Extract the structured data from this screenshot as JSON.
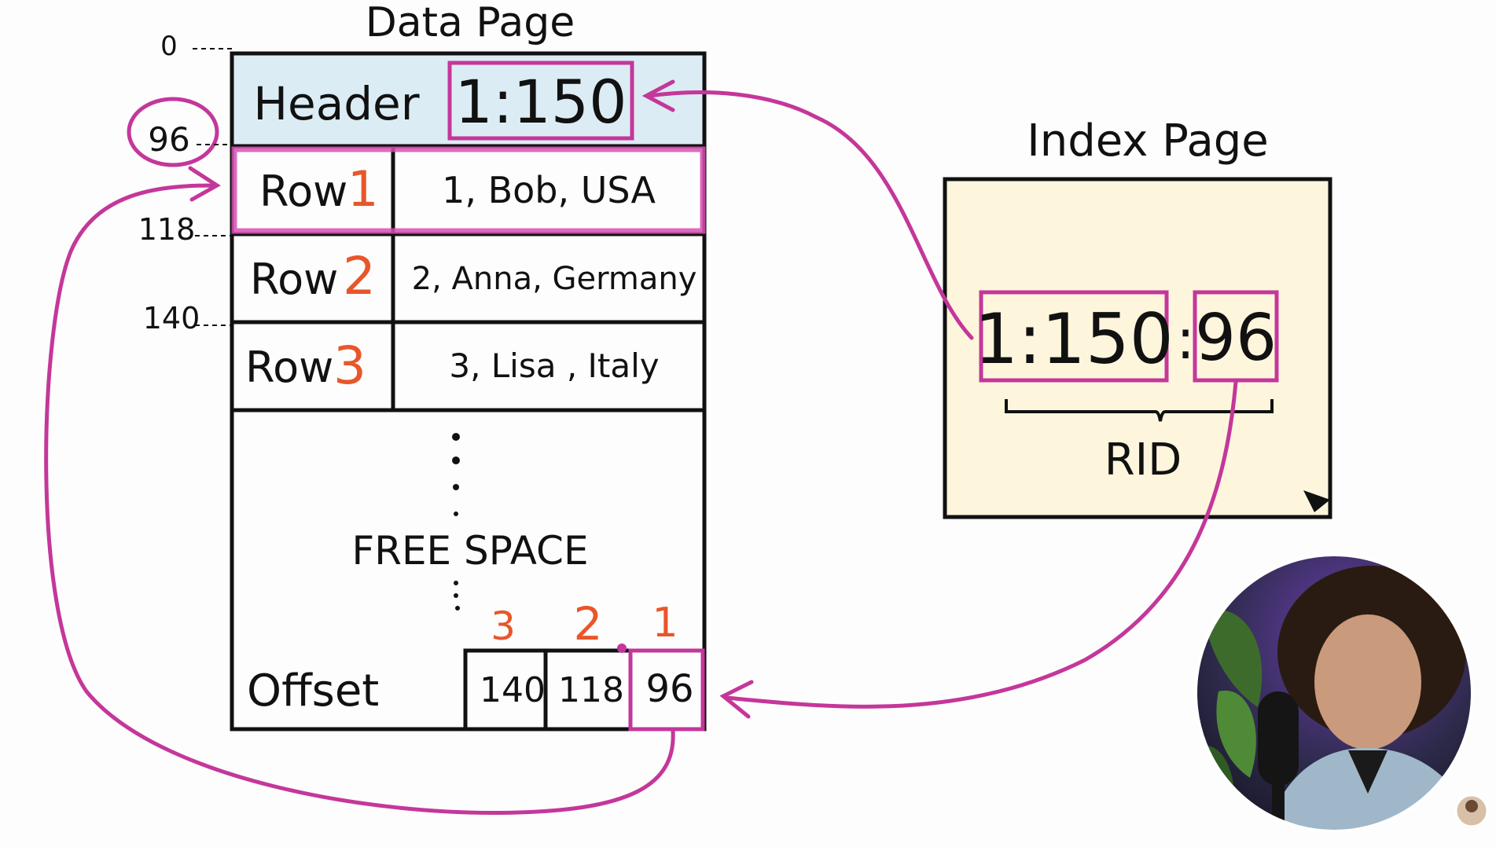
{
  "data_page": {
    "title": "Data Page",
    "header": {
      "label": "Header",
      "page_id": "1:150"
    },
    "rows": [
      {
        "label": "Row",
        "num": "1",
        "value": "1, Bob, USA"
      },
      {
        "label": "Row",
        "num": "2",
        "value": "2, Anna, Germany"
      },
      {
        "label": "Row",
        "num": "3",
        "value": "3, Lisa , Italy"
      }
    ],
    "free_space_label": "FREE SPACE",
    "offset_label": "Offset",
    "offset_slots": [
      {
        "num": "3",
        "value": "140"
      },
      {
        "num": "2",
        "value": "118"
      },
      {
        "num": "1",
        "value": "96"
      }
    ]
  },
  "byte_offsets": [
    "0",
    "96",
    "118",
    "140"
  ],
  "index_page": {
    "title": "Index Page",
    "page_id": "1:150",
    "separator": ":",
    "slot": "96",
    "rid_label": "RID"
  },
  "colors": {
    "accent": "#c4379a",
    "number": "#e8562a",
    "header_fill": "#dcecf4",
    "index_fill": "#fdf6dd",
    "ink": "#111111"
  }
}
